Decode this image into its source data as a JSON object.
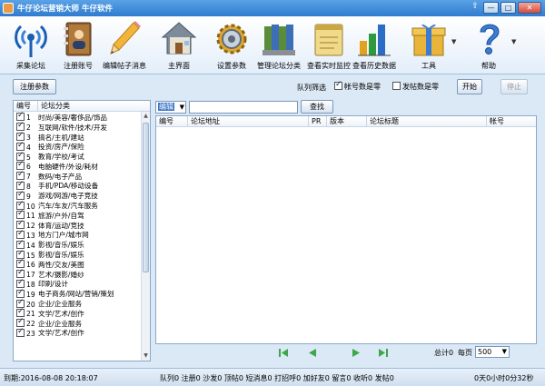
{
  "window": {
    "title": "牛仔论坛营销大师 牛仔软件",
    "buttons": {
      "minimize": "—",
      "maximize": "□",
      "close": "✕",
      "up": "⇧"
    }
  },
  "toolbar": {
    "items": [
      {
        "label": "采集论坛",
        "icon": "antenna-icon"
      },
      {
        "label": "注册账号",
        "icon": "address-book-icon"
      },
      {
        "label": "编辑帖子消息",
        "icon": "pencil-icon"
      },
      {
        "label": "主界面",
        "icon": "house-icon"
      },
      {
        "label": "设置参数",
        "icon": "gears-icon"
      },
      {
        "label": "管理论坛分类",
        "icon": "folders-icon"
      },
      {
        "label": "查看实时监控",
        "icon": "notepad-icon"
      },
      {
        "label": "查看历史数据",
        "icon": "bar-chart-icon"
      },
      {
        "label": "工具",
        "icon": "gift-box-icon"
      },
      {
        "label": "帮助",
        "icon": "question-mark-icon"
      }
    ]
  },
  "controls": {
    "register_params": "注册参数",
    "queue_filter_label": "队列筛选",
    "account_zero_label": "帐号数是零",
    "account_zero_checked": true,
    "post_zero_label": "发帖数是零",
    "post_zero_checked": false,
    "start": "开始",
    "stop": "停止"
  },
  "categories": {
    "headers": {
      "num": "编号",
      "name": "论坛分类"
    },
    "rows": [
      {
        "num": "1",
        "name": "时尚/美容/奢侈品/饰品"
      },
      {
        "num": "2",
        "name": "互联网/软件/技术/开发"
      },
      {
        "num": "3",
        "name": "搞名/主机/建站"
      },
      {
        "num": "4",
        "name": "投资/房产/保险"
      },
      {
        "num": "5",
        "name": "教育/学校/考试"
      },
      {
        "num": "6",
        "name": "电脑硬件/外设/耗材"
      },
      {
        "num": "7",
        "name": "数码/电子产品"
      },
      {
        "num": "8",
        "name": "手机/PDA/移动设备"
      },
      {
        "num": "9",
        "name": "游戏/网游/电子竞技"
      },
      {
        "num": "10",
        "name": "汽车/车友/汽车服务"
      },
      {
        "num": "11",
        "name": "旅游/户外/自驾"
      },
      {
        "num": "12",
        "name": "体育/运动/竞技"
      },
      {
        "num": "13",
        "name": "地方门户/城市网"
      },
      {
        "num": "14",
        "name": "影视/音乐/娱乐"
      },
      {
        "num": "15",
        "name": "影视/音乐/娱乐"
      },
      {
        "num": "16",
        "name": "两性/交友/美图"
      },
      {
        "num": "17",
        "name": "艺术/摄影/婚纱"
      },
      {
        "num": "18",
        "name": "印刷/设计"
      },
      {
        "num": "19",
        "name": "电子商务/网站/营销/策划"
      },
      {
        "num": "20",
        "name": "企业/企业服务"
      },
      {
        "num": "21",
        "name": "文学/艺术/创作"
      },
      {
        "num": "22",
        "name": "企业/企业服务"
      },
      {
        "num": "23",
        "name": "文学/艺术/创作"
      }
    ]
  },
  "filter": {
    "select_value": "编辑",
    "search_value": "",
    "search_button": "查找"
  },
  "grid": {
    "columns": [
      "编号",
      "论坛地址",
      "PR",
      "版本",
      "论坛标题",
      "帐号"
    ]
  },
  "pager": {
    "total": "总计0",
    "per_page_label": "每页",
    "per_page_value": "500"
  },
  "status": {
    "expires": "到期:2016-08-08 20:18:07",
    "counters": "队列0 注册0 沙发0 顶帖0 短消息0 打招呼0 加好友0 留言0 收听0 发帖0",
    "elapsed": "0天0小时0分32秒"
  },
  "colors": {
    "title_bar": "#2f7ccf",
    "window_bg": "#dbe8f5",
    "border": "#8aa8c8"
  }
}
